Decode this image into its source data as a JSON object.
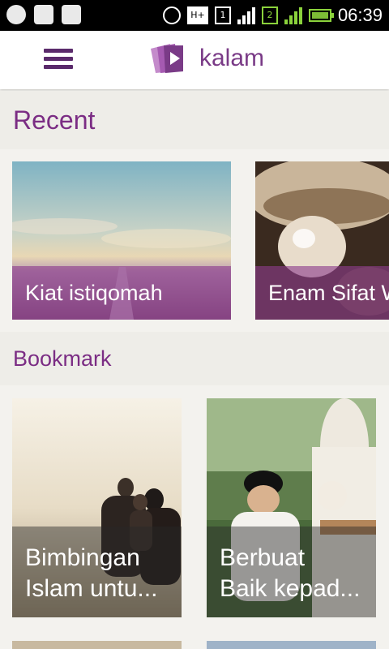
{
  "status_bar": {
    "time": "06:39",
    "network_label": "H+",
    "sim1_label": "1",
    "sim2_label": "2",
    "icons": [
      "whatsapp-icon",
      "image-icon",
      "bbm-icon",
      "alarm-icon",
      "network-icon",
      "sim1-icon",
      "signal-icon",
      "sim2-icon",
      "signal-icon",
      "battery-charging-icon"
    ]
  },
  "app_bar": {
    "logo_text": "kalam",
    "menu_icon": "hamburger-menu-icon"
  },
  "recent": {
    "title": "Recent",
    "cards": [
      {
        "label": "Kiat istiqomah"
      },
      {
        "label": "Enam Sifat W"
      }
    ]
  },
  "bookmark": {
    "title": "Bookmark",
    "cards": [
      {
        "line1": "Bimbingan",
        "line2": "Islam untu..."
      },
      {
        "line1": "Berbuat",
        "line2": "Baik kepad..."
      }
    ]
  },
  "colors": {
    "brand": "#7a3b87",
    "header_bg": "#eeede8",
    "recent_overlay": "#8c3c8c"
  }
}
